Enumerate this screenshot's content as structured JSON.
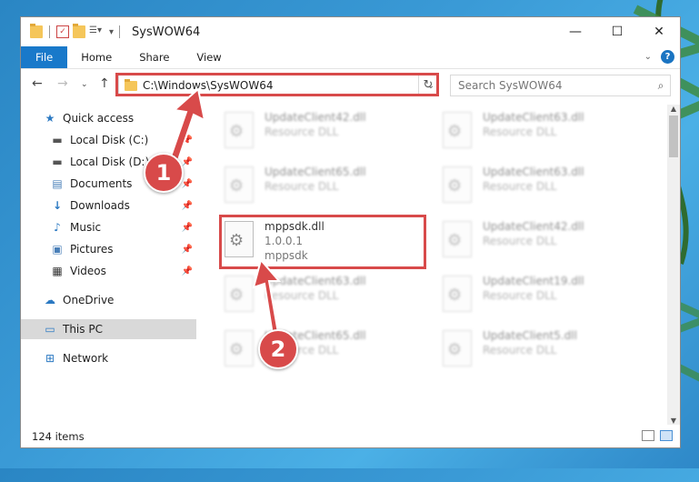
{
  "window": {
    "title": "SysWOW64"
  },
  "controls": {
    "minimize": "—",
    "maximize": "☐",
    "close": "✕"
  },
  "ribbon": {
    "tabs": [
      "File",
      "Home",
      "Share",
      "View"
    ]
  },
  "address": {
    "path": "C:\\Windows\\SysWOW64"
  },
  "search": {
    "placeholder": "Search SysWOW64"
  },
  "sidebar": {
    "items": [
      {
        "label": "Quick access",
        "icon": "star-icon"
      },
      {
        "label": "Local Disk (C:)",
        "icon": "drive-icon",
        "pinned": true
      },
      {
        "label": "Local Disk (D:)",
        "icon": "drive-icon",
        "pinned": true
      },
      {
        "label": "Documents",
        "icon": "documents-icon",
        "pinned": true
      },
      {
        "label": "Downloads",
        "icon": "download-icon",
        "pinned": true
      },
      {
        "label": "Music",
        "icon": "music-icon",
        "pinned": true
      },
      {
        "label": "Pictures",
        "icon": "pictures-icon",
        "pinned": true
      },
      {
        "label": "Videos",
        "icon": "videos-icon",
        "pinned": true
      },
      {
        "label": "OneDrive",
        "icon": "cloud-icon"
      },
      {
        "label": "This PC",
        "icon": "computer-icon",
        "selected": true
      },
      {
        "label": "Network",
        "icon": "network-icon"
      }
    ]
  },
  "files": [
    {
      "name": "UpdateClient42.dll",
      "sub": "Resource DLL",
      "blurred": true
    },
    {
      "name": "UpdateClient63.dll",
      "sub": "Resource DLL",
      "blurred": true
    },
    {
      "name": "UpdateClient65.dll",
      "sub": "Resource DLL",
      "blurred": true
    },
    {
      "name": "UpdateClient63.dll",
      "sub": "Resource DLL",
      "blurred": true
    },
    {
      "name": "mppsdk.dll",
      "sub": "1.0.0.1",
      "sub2": "mppsdk",
      "blurred": false
    },
    {
      "name": "UpdateClient42.dll",
      "sub": "Resource DLL",
      "blurred": true
    },
    {
      "name": "UpdateClient63.dll",
      "sub": "Resource DLL",
      "blurred": true
    },
    {
      "name": "UpdateClient19.dll",
      "sub": "Resource DLL",
      "blurred": true
    },
    {
      "name": "UpdateClient65.dll",
      "sub": "Resource DLL",
      "blurred": true
    },
    {
      "name": "UpdateClient5.dll",
      "sub": "Resource DLL",
      "blurred": true
    }
  ],
  "status": {
    "count": "124 items"
  },
  "callouts": {
    "one": "1",
    "two": "2"
  },
  "colors": {
    "accent": "#1979ca",
    "callout": "#d84a4a"
  }
}
